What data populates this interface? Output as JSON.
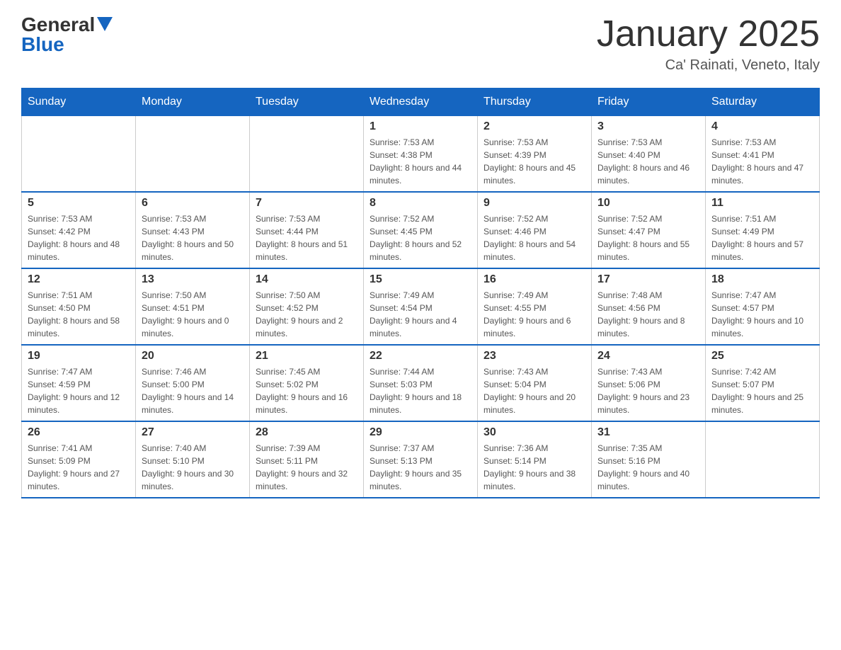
{
  "header": {
    "logo_general": "General",
    "logo_blue": "Blue",
    "month_title": "January 2025",
    "location": "Ca' Rainati, Veneto, Italy"
  },
  "days_of_week": [
    "Sunday",
    "Monday",
    "Tuesday",
    "Wednesday",
    "Thursday",
    "Friday",
    "Saturday"
  ],
  "weeks": [
    [
      {
        "day": "",
        "info": ""
      },
      {
        "day": "",
        "info": ""
      },
      {
        "day": "",
        "info": ""
      },
      {
        "day": "1",
        "info": "Sunrise: 7:53 AM\nSunset: 4:38 PM\nDaylight: 8 hours and 44 minutes."
      },
      {
        "day": "2",
        "info": "Sunrise: 7:53 AM\nSunset: 4:39 PM\nDaylight: 8 hours and 45 minutes."
      },
      {
        "day": "3",
        "info": "Sunrise: 7:53 AM\nSunset: 4:40 PM\nDaylight: 8 hours and 46 minutes."
      },
      {
        "day": "4",
        "info": "Sunrise: 7:53 AM\nSunset: 4:41 PM\nDaylight: 8 hours and 47 minutes."
      }
    ],
    [
      {
        "day": "5",
        "info": "Sunrise: 7:53 AM\nSunset: 4:42 PM\nDaylight: 8 hours and 48 minutes."
      },
      {
        "day": "6",
        "info": "Sunrise: 7:53 AM\nSunset: 4:43 PM\nDaylight: 8 hours and 50 minutes."
      },
      {
        "day": "7",
        "info": "Sunrise: 7:53 AM\nSunset: 4:44 PM\nDaylight: 8 hours and 51 minutes."
      },
      {
        "day": "8",
        "info": "Sunrise: 7:52 AM\nSunset: 4:45 PM\nDaylight: 8 hours and 52 minutes."
      },
      {
        "day": "9",
        "info": "Sunrise: 7:52 AM\nSunset: 4:46 PM\nDaylight: 8 hours and 54 minutes."
      },
      {
        "day": "10",
        "info": "Sunrise: 7:52 AM\nSunset: 4:47 PM\nDaylight: 8 hours and 55 minutes."
      },
      {
        "day": "11",
        "info": "Sunrise: 7:51 AM\nSunset: 4:49 PM\nDaylight: 8 hours and 57 minutes."
      }
    ],
    [
      {
        "day": "12",
        "info": "Sunrise: 7:51 AM\nSunset: 4:50 PM\nDaylight: 8 hours and 58 minutes."
      },
      {
        "day": "13",
        "info": "Sunrise: 7:50 AM\nSunset: 4:51 PM\nDaylight: 9 hours and 0 minutes."
      },
      {
        "day": "14",
        "info": "Sunrise: 7:50 AM\nSunset: 4:52 PM\nDaylight: 9 hours and 2 minutes."
      },
      {
        "day": "15",
        "info": "Sunrise: 7:49 AM\nSunset: 4:54 PM\nDaylight: 9 hours and 4 minutes."
      },
      {
        "day": "16",
        "info": "Sunrise: 7:49 AM\nSunset: 4:55 PM\nDaylight: 9 hours and 6 minutes."
      },
      {
        "day": "17",
        "info": "Sunrise: 7:48 AM\nSunset: 4:56 PM\nDaylight: 9 hours and 8 minutes."
      },
      {
        "day": "18",
        "info": "Sunrise: 7:47 AM\nSunset: 4:57 PM\nDaylight: 9 hours and 10 minutes."
      }
    ],
    [
      {
        "day": "19",
        "info": "Sunrise: 7:47 AM\nSunset: 4:59 PM\nDaylight: 9 hours and 12 minutes."
      },
      {
        "day": "20",
        "info": "Sunrise: 7:46 AM\nSunset: 5:00 PM\nDaylight: 9 hours and 14 minutes."
      },
      {
        "day": "21",
        "info": "Sunrise: 7:45 AM\nSunset: 5:02 PM\nDaylight: 9 hours and 16 minutes."
      },
      {
        "day": "22",
        "info": "Sunrise: 7:44 AM\nSunset: 5:03 PM\nDaylight: 9 hours and 18 minutes."
      },
      {
        "day": "23",
        "info": "Sunrise: 7:43 AM\nSunset: 5:04 PM\nDaylight: 9 hours and 20 minutes."
      },
      {
        "day": "24",
        "info": "Sunrise: 7:43 AM\nSunset: 5:06 PM\nDaylight: 9 hours and 23 minutes."
      },
      {
        "day": "25",
        "info": "Sunrise: 7:42 AM\nSunset: 5:07 PM\nDaylight: 9 hours and 25 minutes."
      }
    ],
    [
      {
        "day": "26",
        "info": "Sunrise: 7:41 AM\nSunset: 5:09 PM\nDaylight: 9 hours and 27 minutes."
      },
      {
        "day": "27",
        "info": "Sunrise: 7:40 AM\nSunset: 5:10 PM\nDaylight: 9 hours and 30 minutes."
      },
      {
        "day": "28",
        "info": "Sunrise: 7:39 AM\nSunset: 5:11 PM\nDaylight: 9 hours and 32 minutes."
      },
      {
        "day": "29",
        "info": "Sunrise: 7:37 AM\nSunset: 5:13 PM\nDaylight: 9 hours and 35 minutes."
      },
      {
        "day": "30",
        "info": "Sunrise: 7:36 AM\nSunset: 5:14 PM\nDaylight: 9 hours and 38 minutes."
      },
      {
        "day": "31",
        "info": "Sunrise: 7:35 AM\nSunset: 5:16 PM\nDaylight: 9 hours and 40 minutes."
      },
      {
        "day": "",
        "info": ""
      }
    ]
  ]
}
